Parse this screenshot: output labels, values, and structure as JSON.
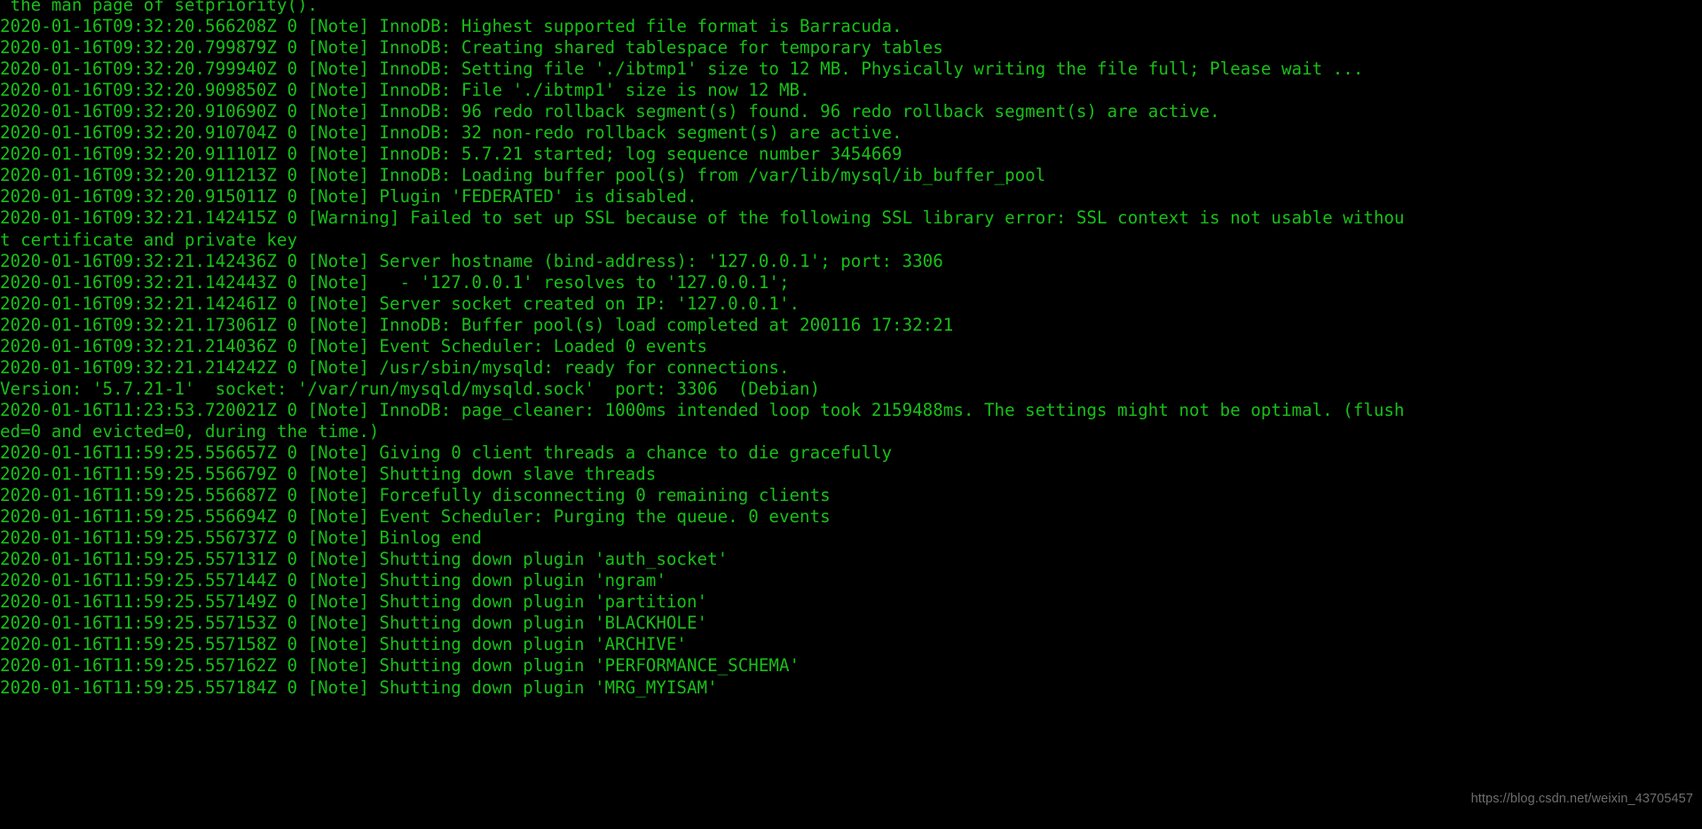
{
  "terminal": {
    "background_color": "#000000",
    "foreground_color": "#18c018",
    "watermark_color": "#6e6e6e",
    "watermark": "https://blog.csdn.net/weixin_43705457",
    "lines": [
      " the man page of setpriority().",
      "2020-01-16T09:32:20.566208Z 0 [Note] InnoDB: Highest supported file format is Barracuda.",
      "2020-01-16T09:32:20.799879Z 0 [Note] InnoDB: Creating shared tablespace for temporary tables",
      "2020-01-16T09:32:20.799940Z 0 [Note] InnoDB: Setting file './ibtmp1' size to 12 MB. Physically writing the file full; Please wait ...",
      "2020-01-16T09:32:20.909850Z 0 [Note] InnoDB: File './ibtmp1' size is now 12 MB.",
      "2020-01-16T09:32:20.910690Z 0 [Note] InnoDB: 96 redo rollback segment(s) found. 96 redo rollback segment(s) are active.",
      "2020-01-16T09:32:20.910704Z 0 [Note] InnoDB: 32 non-redo rollback segment(s) are active.",
      "2020-01-16T09:32:20.911101Z 0 [Note] InnoDB: 5.7.21 started; log sequence number 3454669",
      "2020-01-16T09:32:20.911213Z 0 [Note] InnoDB: Loading buffer pool(s) from /var/lib/mysql/ib_buffer_pool",
      "2020-01-16T09:32:20.915011Z 0 [Note] Plugin 'FEDERATED' is disabled.",
      "2020-01-16T09:32:21.142415Z 0 [Warning] Failed to set up SSL because of the following SSL library error: SSL context is not usable withou",
      "t certificate and private key",
      "2020-01-16T09:32:21.142436Z 0 [Note] Server hostname (bind-address): '127.0.0.1'; port: 3306",
      "2020-01-16T09:32:21.142443Z 0 [Note]   - '127.0.0.1' resolves to '127.0.0.1';",
      "2020-01-16T09:32:21.142461Z 0 [Note] Server socket created on IP: '127.0.0.1'.",
      "2020-01-16T09:32:21.173061Z 0 [Note] InnoDB: Buffer pool(s) load completed at 200116 17:32:21",
      "2020-01-16T09:32:21.214036Z 0 [Note] Event Scheduler: Loaded 0 events",
      "2020-01-16T09:32:21.214242Z 0 [Note] /usr/sbin/mysqld: ready for connections.",
      "Version: '5.7.21-1'  socket: '/var/run/mysqld/mysqld.sock'  port: 3306  (Debian)",
      "2020-01-16T11:23:53.720021Z 0 [Note] InnoDB: page_cleaner: 1000ms intended loop took 2159488ms. The settings might not be optimal. (flush",
      "ed=0 and evicted=0, during the time.)",
      "2020-01-16T11:59:25.556657Z 0 [Note] Giving 0 client threads a chance to die gracefully",
      "2020-01-16T11:59:25.556679Z 0 [Note] Shutting down slave threads",
      "2020-01-16T11:59:25.556687Z 0 [Note] Forcefully disconnecting 0 remaining clients",
      "2020-01-16T11:59:25.556694Z 0 [Note] Event Scheduler: Purging the queue. 0 events",
      "2020-01-16T11:59:25.556737Z 0 [Note] Binlog end",
      "2020-01-16T11:59:25.557131Z 0 [Note] Shutting down plugin 'auth_socket'",
      "2020-01-16T11:59:25.557144Z 0 [Note] Shutting down plugin 'ngram'",
      "2020-01-16T11:59:25.557149Z 0 [Note] Shutting down plugin 'partition'",
      "2020-01-16T11:59:25.557153Z 0 [Note] Shutting down plugin 'BLACKHOLE'",
      "2020-01-16T11:59:25.557158Z 0 [Note] Shutting down plugin 'ARCHIVE'",
      "2020-01-16T11:59:25.557162Z 0 [Note] Shutting down plugin 'PERFORMANCE_SCHEMA'",
      "2020-01-16T11:59:25.557184Z 0 [Note] Shutting down plugin 'MRG_MYISAM'"
    ]
  }
}
